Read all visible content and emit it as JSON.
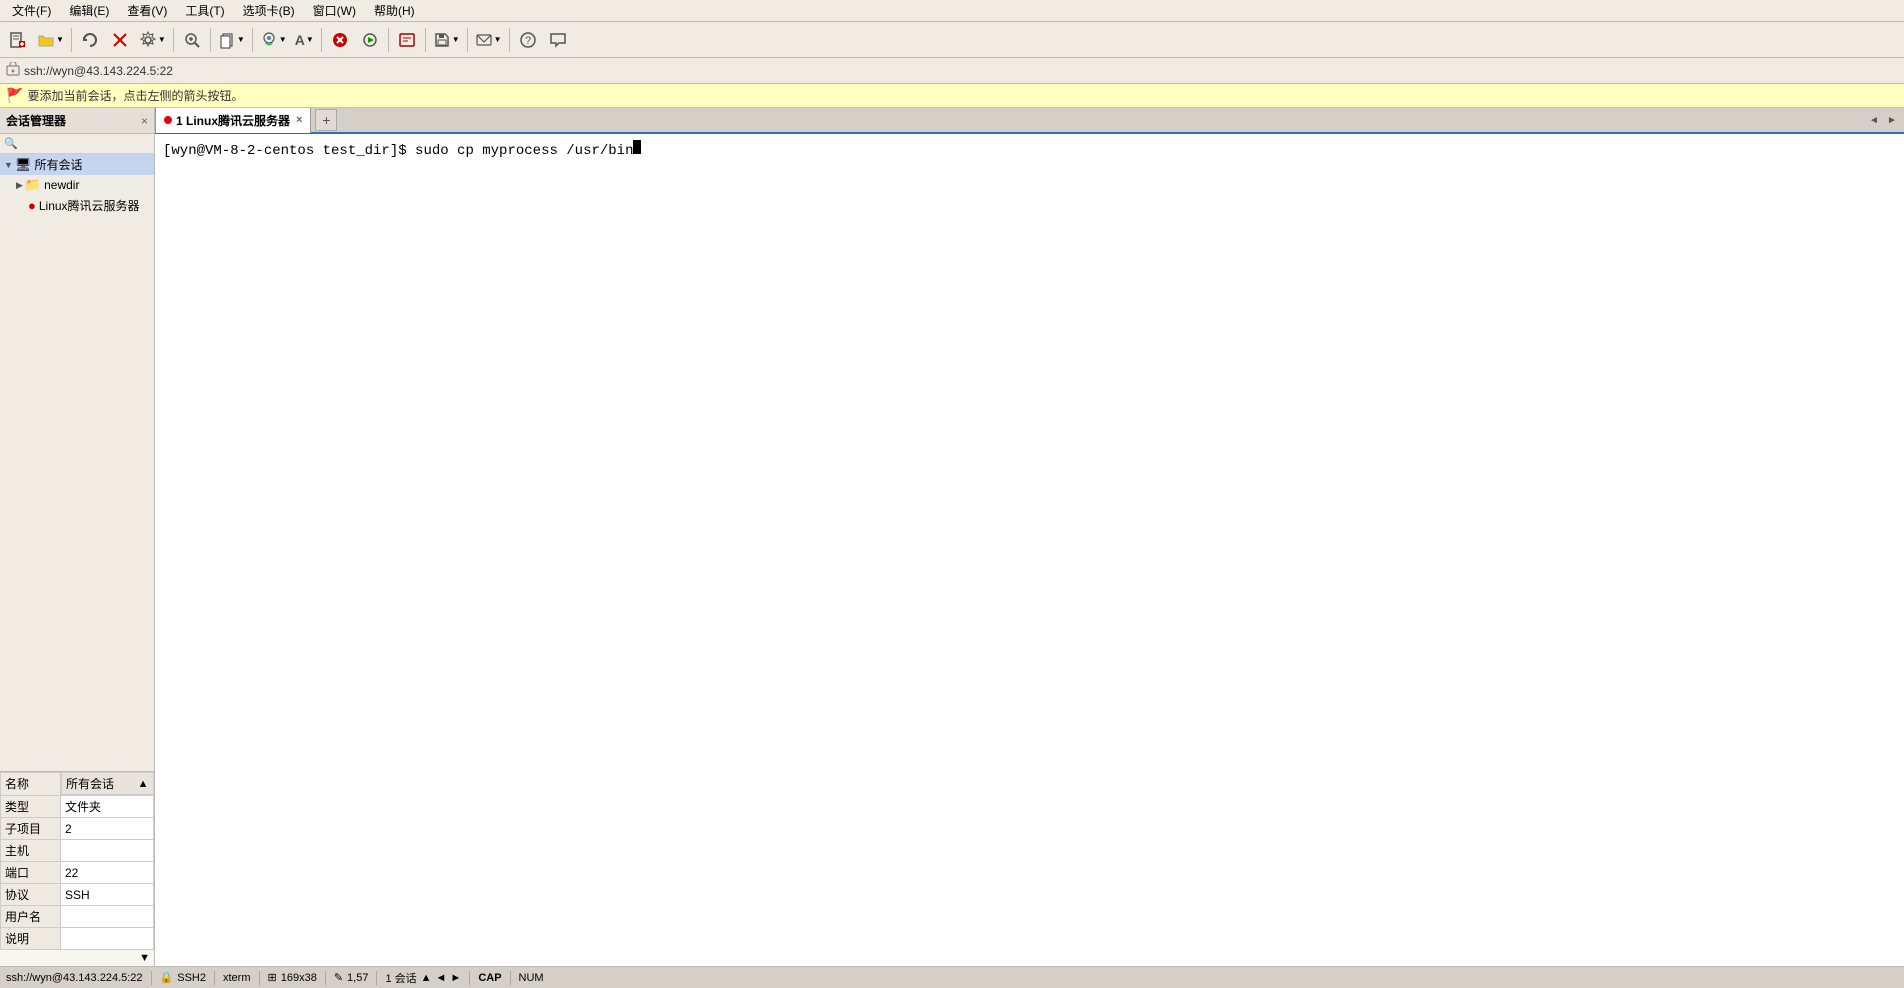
{
  "menubar": {
    "items": [
      "文件(F)",
      "编辑(E)",
      "查看(V)",
      "工具(T)",
      "选项卡(B)",
      "窗口(W)",
      "帮助(H)"
    ]
  },
  "toolbar": {
    "buttons": [
      {
        "name": "new-btn",
        "icon": "📄"
      },
      {
        "name": "open-btn",
        "icon": "📂",
        "has_dropdown": true
      },
      {
        "name": "sep1"
      },
      {
        "name": "reconnect-btn",
        "icon": "🔄"
      },
      {
        "name": "disconnect-btn",
        "icon": "⛔"
      },
      {
        "name": "config-btn",
        "icon": "⚙️",
        "has_dropdown": true
      },
      {
        "name": "sep2"
      },
      {
        "name": "zoom-btn",
        "icon": "🔍"
      },
      {
        "name": "copy-btn",
        "icon": "📋",
        "has_dropdown": true
      },
      {
        "name": "sep3"
      },
      {
        "name": "color-btn",
        "icon": "🎨",
        "has_dropdown": true
      },
      {
        "name": "font-btn",
        "icon": "A",
        "has_dropdown": true
      },
      {
        "name": "sep4"
      },
      {
        "name": "stop-btn",
        "icon": "🚫"
      },
      {
        "name": "rec-btn",
        "icon": "⏺"
      },
      {
        "name": "sep5"
      },
      {
        "name": "script-btn",
        "icon": "📜"
      },
      {
        "name": "sep6"
      },
      {
        "name": "save-btn",
        "icon": "💾",
        "has_dropdown": true
      },
      {
        "name": "sep7"
      },
      {
        "name": "send-btn",
        "icon": "📨",
        "has_dropdown": true
      },
      {
        "name": "sep8"
      },
      {
        "name": "help-btn",
        "icon": "❓"
      },
      {
        "name": "chat-btn",
        "icon": "💬"
      }
    ]
  },
  "addressbar": {
    "text": "ssh://wyn@43.143.224.5:22"
  },
  "hintbar": {
    "text": "要添加当前会话，点击左侧的箭头按钮。"
  },
  "sidebar": {
    "title": "会话管理器",
    "close_label": "×",
    "tree": {
      "root": "所有会话",
      "items": [
        {
          "label": "newdir",
          "type": "folder",
          "indent": 1
        },
        {
          "label": "Linux腾讯云服务器",
          "type": "server",
          "indent": 2
        }
      ]
    },
    "properties": {
      "headers": [
        "名称",
        "所有会话"
      ],
      "rows": [
        {
          "key": "类型",
          "value": "文件夹"
        },
        {
          "key": "子项目",
          "value": "2"
        },
        {
          "key": "主机",
          "value": ""
        },
        {
          "key": "端口",
          "value": "22"
        },
        {
          "key": "协议",
          "value": "SSH"
        },
        {
          "key": "用户名",
          "value": ""
        },
        {
          "key": "说明",
          "value": ""
        }
      ]
    }
  },
  "tabs": [
    {
      "label": "1 Linux腾讯云服务器",
      "active": true,
      "has_dot": true
    }
  ],
  "tab_add_label": "+",
  "terminal": {
    "lines": [
      {
        "prompt": "[wyn@VM-8-2-centos test_dir]$ ",
        "command": "sudo cp myprocess /usr/bin"
      }
    ]
  },
  "statusbar": {
    "left": {
      "connection": "ssh://wyn@43.143.224.5:22"
    },
    "sections": [
      {
        "label": "SSH2"
      },
      {
        "label": "xterm"
      },
      {
        "label": "169x38"
      },
      {
        "label": "1,57"
      },
      {
        "label": "1 会话"
      },
      {
        "label": "CAP"
      },
      {
        "label": "NUM"
      }
    ],
    "up_arrow": "▲",
    "nav_arrows": [
      "◄",
      "►"
    ]
  }
}
